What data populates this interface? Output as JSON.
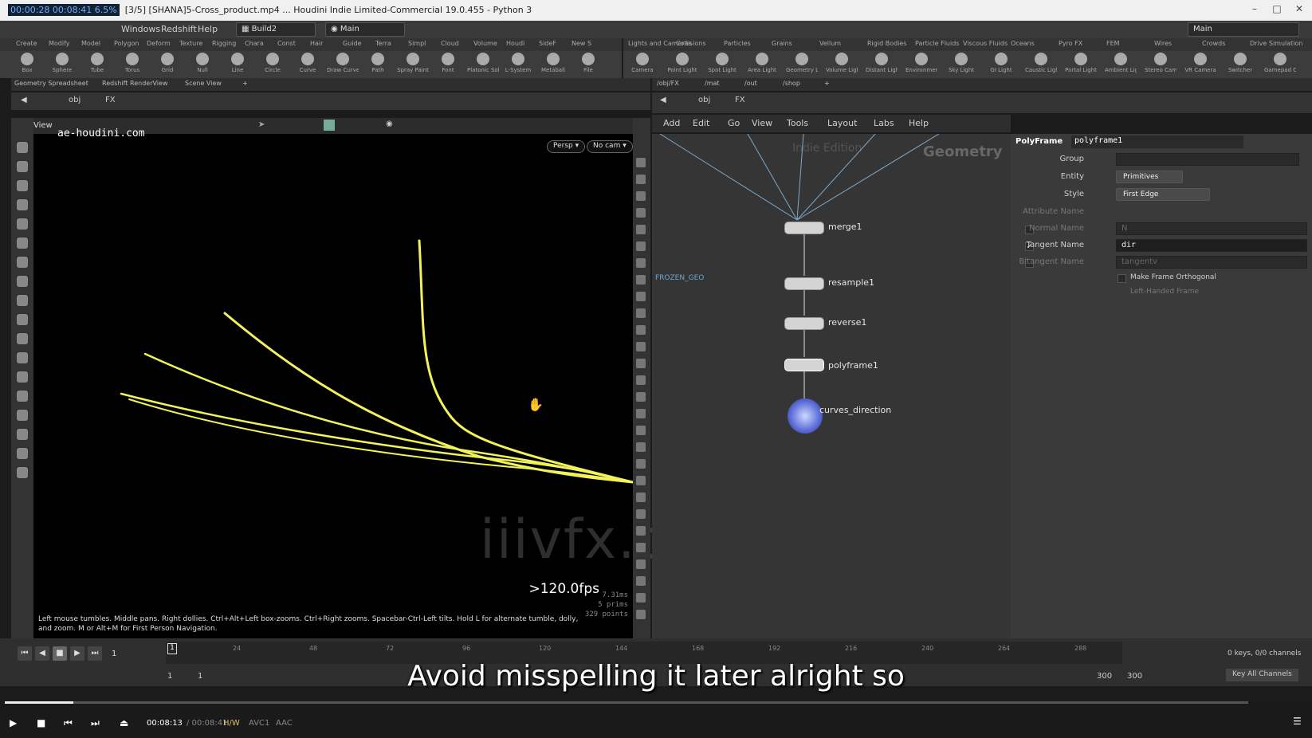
{
  "window": {
    "title": "[3/5] [SHANA]5-Cross_product.mp4 ... Houdini Indie Limited-Commercial 19.0.455 - Python 3",
    "time_badge": "00:00:28 00:08:41 6.5%"
  },
  "menubar": {
    "items": [
      "Windows",
      "Redshift",
      "Help"
    ],
    "build": "Build2",
    "desktop": "Main",
    "right_desktop": "Main"
  },
  "shelf_left": {
    "tabs": [
      "Create",
      "Modify",
      "Model",
      "Polygon",
      "Deform",
      "Texture",
      "Rigging",
      "Chara",
      "Const",
      "Hair",
      "Guide",
      "Terra",
      "Simpl",
      "Cloud",
      "Volume",
      "Houdi",
      "SideF",
      "New S"
    ],
    "tools": [
      "Box",
      "Sphere",
      "Tube",
      "Torus",
      "Grid",
      "Null",
      "Line",
      "Circle",
      "Curve",
      "Draw Curve",
      "Path",
      "Spray Paint",
      "Font",
      "Platonic Solids",
      "L-System",
      "Metaball",
      "File"
    ]
  },
  "shelf_right": {
    "tabs": [
      "Lights and Cameras",
      "Collisions",
      "Particles",
      "Grains",
      "Vellum",
      "Rigid Bodies",
      "Particle Fluids",
      "Viscous Fluids",
      "Oceans",
      "Pyro FX",
      "FEM",
      "Wires",
      "Crowds",
      "Drive Simulation"
    ],
    "tools": [
      "Camera",
      "Point Light",
      "Spot Light",
      "Area Light",
      "Geometry Light",
      "Volume Light",
      "Distant Light",
      "Environment Light",
      "Sky Light",
      "GI Light",
      "Caustic Light",
      "Portal Light",
      "Ambient Light",
      "Stereo Camera",
      "VR Camera",
      "Switcher",
      "Gamepad Camera"
    ]
  },
  "left_pane": {
    "tabs": [
      "Geometry Spreadsheet",
      "Redshift RenderView",
      "Scene View"
    ],
    "path": [
      "obj",
      "FX"
    ],
    "view_label": "View",
    "watermark": "ae-houdini.com",
    "persp": "Persp",
    "cam": "No cam",
    "fps": ">120.0fps",
    "stats": [
      "7.31ms",
      "5  prims",
      "329 points"
    ],
    "help": "Left mouse tumbles. Middle pans. Right dollies. Ctrl+Alt+Left box-zooms. Ctrl+Right zooms. Spacebar-Ctrl-Left tilts. Hold L for alternate tumble, dolly, and zoom. M or Alt+M for First Person Navigation.",
    "overlay": "iiivfx.com"
  },
  "right_pane": {
    "tabs": [
      "/obj/FX",
      "/mat",
      "/out",
      "/shop"
    ],
    "path": [
      "obj",
      "FX"
    ],
    "menu": [
      "Add",
      "Edit",
      "Go",
      "View",
      "Tools",
      "Layout",
      "Labs",
      "Help"
    ],
    "network_title": "Geometry",
    "network_subtitle": "Indie Edition",
    "side_label": "FROZEN_GEO",
    "nodes": [
      "merge1",
      "resample1",
      "reverse1",
      "polyframe1",
      "curves_direction"
    ]
  },
  "parm": {
    "node_type": "PolyFrame",
    "node_name": "polyframe1",
    "group_label": "Group",
    "group_value": "",
    "entity_label": "Entity",
    "entity_value": "Primitives",
    "style_label": "Style",
    "style_value": "First Edge",
    "attr_label": "Attribute Name",
    "normal_label": "Normal Name",
    "normal_value": "N",
    "tangent_label": "Tangent Name",
    "tangent_value": "dir",
    "bitangent_label": "Bitangent Name",
    "bitangent_value": "tangentv",
    "ortho_label": "Make Frame Orthogonal",
    "left_label": "Left-Handed Frame"
  },
  "playbar": {
    "frame": "1",
    "start": "1",
    "start2": "1",
    "end": "300",
    "end2": "300",
    "ticks": [
      "24",
      "48",
      "72",
      "96",
      "120",
      "144",
      "168",
      "192",
      "216",
      "240",
      "264",
      "288"
    ],
    "keys": "0 keys, 0/0 channels",
    "key_all": "Key All Channels"
  },
  "subtitle": "Avoid misspelling it later alright so",
  "media": {
    "time": "00:08:13",
    "duration": "/ 00:08:41",
    "hw": "H/W",
    "vcodec": "AVC1",
    "acodec": "AAC",
    "progress": 0.055
  },
  "colors": {
    "curve": "#f2f25a",
    "link": "#7fa8c8"
  }
}
